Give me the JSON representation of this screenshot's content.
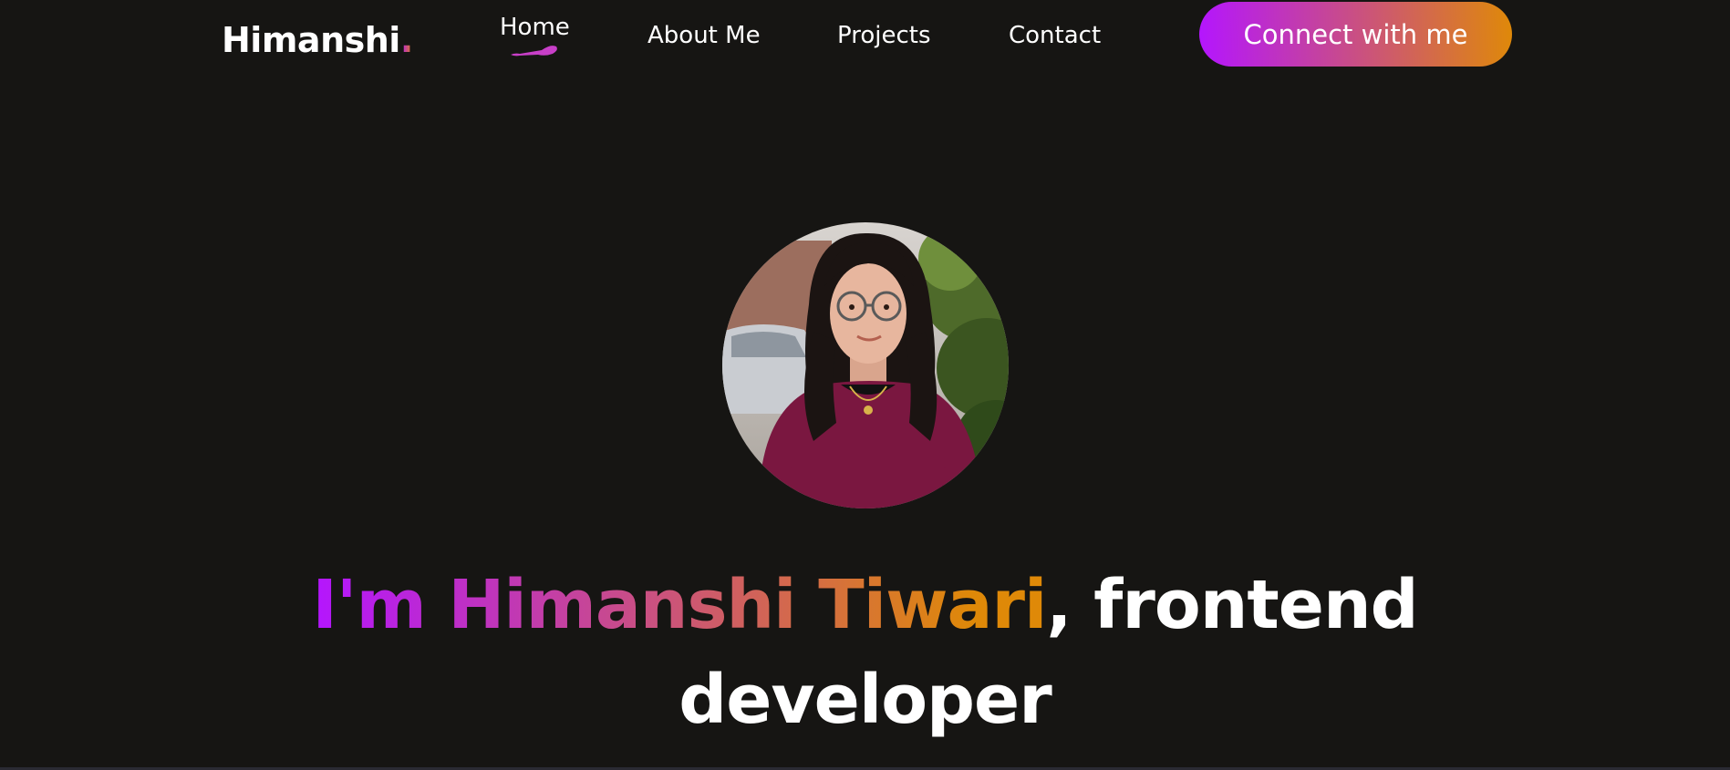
{
  "navbar": {
    "logo_text": "Himanshi",
    "logo_dot": ".",
    "items": [
      {
        "label": "Home",
        "active": true
      },
      {
        "label": "About Me",
        "active": false
      },
      {
        "label": "Projects",
        "active": false
      },
      {
        "label": "Contact",
        "active": false
      }
    ],
    "cta_label": "Connect with me"
  },
  "hero": {
    "name_text": "I'm Himanshi Tiwari",
    "rest_line1": ", frontend",
    "rest_line2": "developer"
  },
  "colors": {
    "background": "#161513",
    "gradient_start": "#B415FF",
    "gradient_end": "#DF8908",
    "text": "#FFFFFF"
  },
  "icons": {
    "active_nav_indicator": "brush-stroke-underline",
    "avatar": "profile-photo"
  }
}
